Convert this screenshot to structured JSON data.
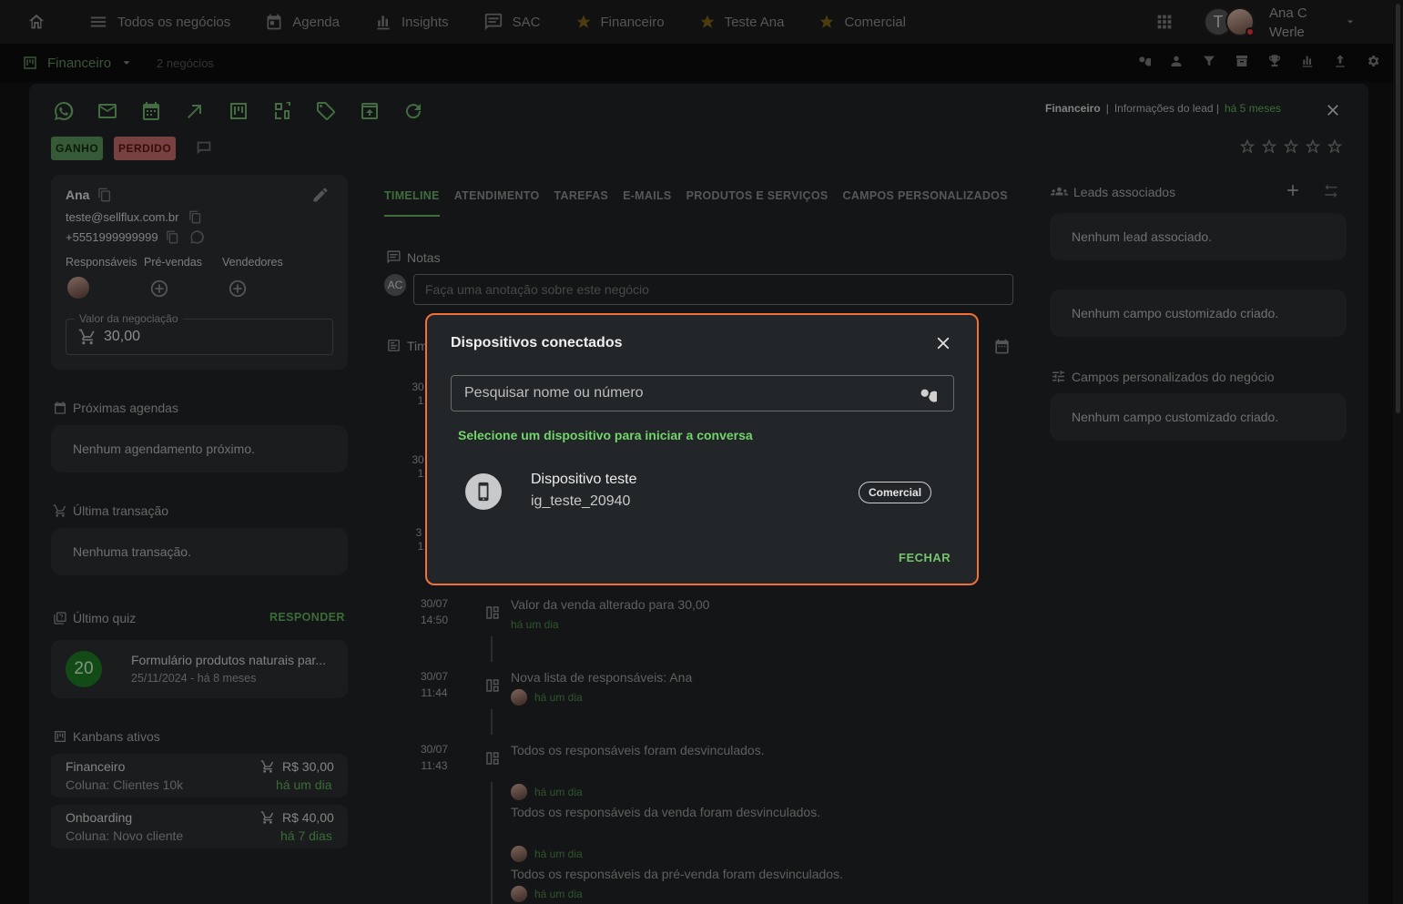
{
  "topbar": {
    "nav": [
      {
        "label": "Todos os negócios",
        "icon": "menu-icon"
      },
      {
        "label": "Agenda",
        "icon": "calendar-icon"
      },
      {
        "label": "Insights",
        "icon": "bar-chart-icon"
      },
      {
        "label": "SAC",
        "icon": "chat-icon"
      },
      {
        "label": "Financeiro",
        "icon": "star-icon"
      },
      {
        "label": "Teste Ana",
        "icon": "star-icon"
      },
      {
        "label": "Comercial",
        "icon": "star-icon"
      }
    ],
    "avatar_initial": "T",
    "user_name_line1": "Ana C",
    "user_name_line2": "Werle"
  },
  "subbar": {
    "board": "Financeiro",
    "count": "2 negócios"
  },
  "header": {
    "pipeline": "Financeiro",
    "info": "Informações do lead |",
    "time": "há 5 meses"
  },
  "status": {
    "won": "GANHO",
    "lost": "PERDIDO"
  },
  "contact": {
    "name": "Ana",
    "email": "teste@sellflux.com.br",
    "phone": "+5551999999999",
    "roles": [
      "Responsáveis",
      "Pré-vendas",
      "Vendedores"
    ],
    "value_label": "Valor da negociação",
    "value": "30,00"
  },
  "agendas": {
    "title": "Próximas agendas",
    "empty": "Nenhum agendamento próximo."
  },
  "transaction": {
    "title": "Última transação",
    "empty": "Nenhuma transação."
  },
  "quiz": {
    "title": "Último quiz",
    "action": "RESPONDER",
    "score": "20",
    "name": "Formulário produtos naturais par...",
    "date": "25/11/2024 - há 8 meses"
  },
  "kanbans": {
    "title": "Kanbans ativos",
    "items": [
      {
        "name": "Financeiro",
        "column": "Coluna: Clientes 10k",
        "value": "R$ 30,00",
        "time": "há um dia"
      },
      {
        "name": "Onboarding",
        "column": "Coluna: Novo cliente",
        "value": "R$ 40,00",
        "time": "há 7 dias"
      }
    ]
  },
  "tabs": [
    "TIMELINE",
    "ATENDIMENTO",
    "TAREFAS",
    "E-MAILS",
    "PRODUTOS E SERVIÇOS",
    "CAMPOS PERSONALIZADOS"
  ],
  "notes": {
    "title": "Notas",
    "initials": "AC",
    "placeholder": "Faça uma anotação sobre este negócio"
  },
  "timeline": {
    "title_partial": "Tim",
    "hidden_dates": [
      "30",
      "1",
      "30",
      "1",
      "3",
      "1"
    ],
    "events": [
      {
        "date": "30/07",
        "time": "14:50",
        "text": "Valor da venda alterado para 30,00",
        "sub": "há um dia"
      },
      {
        "date": "30/07",
        "time": "11:44",
        "text": "Nova lista de responsáveis: Ana",
        "sub": "há um dia"
      },
      {
        "date": "30/07",
        "time": "11:43",
        "text": "Todos os responsáveis foram desvinculados."
      }
    ],
    "extra": [
      {
        "sub": "há um dia",
        "text": "Todos os responsáveis da venda foram desvinculados."
      },
      {
        "sub": "há um dia",
        "text": "Todos os responsáveis da pré-venda foram desvinculados."
      },
      {
        "sub": "há um dia"
      }
    ]
  },
  "right": {
    "leads_title": "Leads associados",
    "leads_empty": "Nenhum lead associado.",
    "custom_empty": "Nenhum campo customizado criado.",
    "deal_fields_title": "Campos personalizados do negócio",
    "deal_fields_empty": "Nenhum campo customizado criado."
  },
  "dialog": {
    "title": "Dispositivos conectados",
    "search_placeholder": "Pesquisar nome ou número",
    "hint": "Selecione um dispositivo para iniciar a conversa",
    "device": {
      "name": "Dispositivo teste",
      "id": "ig_teste_20940",
      "tag": "Comercial"
    },
    "close_label": "FECHAR"
  },
  "colors": {
    "accent": "#68b063",
    "dialog_border": "#f26f3a",
    "won": "#58915a",
    "lost": "#c06a6a"
  }
}
